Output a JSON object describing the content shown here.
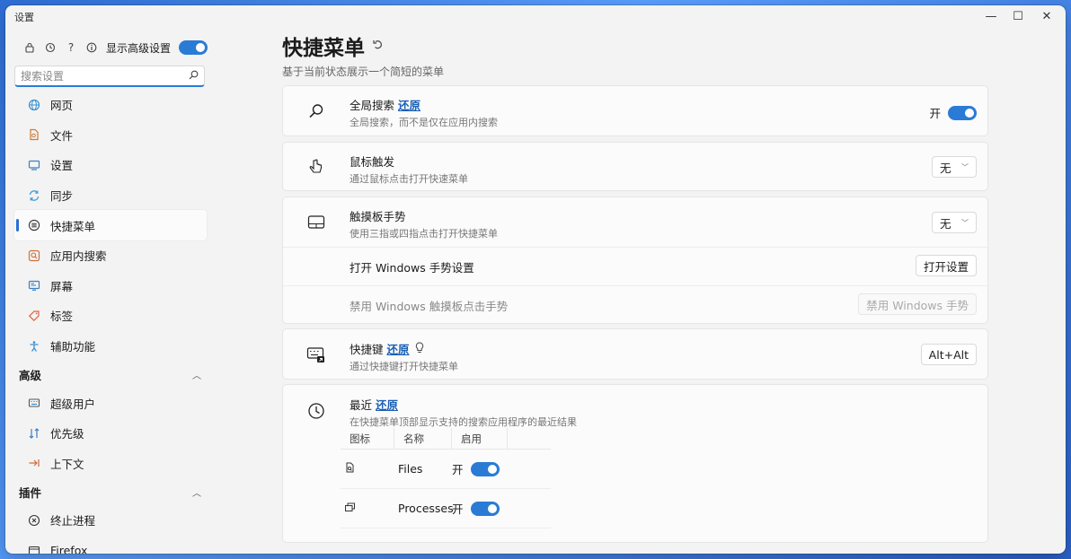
{
  "window": {
    "title": "设置",
    "min_glyph": "—",
    "max_glyph": "☐",
    "close_glyph": "✕"
  },
  "sidebar": {
    "top_icons": [
      "lock-icon",
      "history-icon",
      "help-icon",
      "info-icon"
    ],
    "help_glyph": "?",
    "show_advanced_label": "显示高级设置",
    "search_placeholder": "搜索设置",
    "items": [
      {
        "label": "网页",
        "icon": "globe-icon"
      },
      {
        "label": "文件",
        "icon": "file-icon"
      },
      {
        "label": "设置",
        "icon": "monitor-icon"
      },
      {
        "label": "同步",
        "icon": "sync-icon"
      },
      {
        "label": "快捷菜单",
        "icon": "menu-icon"
      },
      {
        "label": "应用内搜索",
        "icon": "app-search-icon"
      },
      {
        "label": "屏幕",
        "icon": "screen-icon"
      },
      {
        "label": "标签",
        "icon": "tag-icon"
      },
      {
        "label": "辅助功能",
        "icon": "accessibility-icon"
      }
    ],
    "section_advanced": "高级",
    "advanced_items": [
      {
        "label": "超级用户",
        "icon": "keyboard-icon"
      },
      {
        "label": "优先级",
        "icon": "sort-icon"
      },
      {
        "label": "上下文",
        "icon": "arrow-right-bar-icon"
      }
    ],
    "section_plugins": "插件",
    "plugin_items": [
      {
        "label": "终止进程",
        "icon": "close-circle-icon"
      },
      {
        "label": "Firefox",
        "icon": "firefox-icon"
      }
    ]
  },
  "main": {
    "title": "快捷菜单",
    "subtitle": "基于当前状态展示一个简短的菜单",
    "reset_label": "还原",
    "global_search": {
      "title": "全局搜索",
      "desc": "全局搜索，而不是仅在应用内搜索",
      "state_label": "开"
    },
    "mouse_trigger": {
      "title": "鼠标触发",
      "desc": "通过鼠标点击打开快速菜单",
      "value": "无"
    },
    "touchpad": {
      "title": "触摸板手势",
      "desc": "使用三指或四指点击打开快捷菜单",
      "value": "无",
      "open_settings_title": "打开 Windows 手势设置",
      "open_settings_button": "打开设置",
      "disable_title": "禁用 Windows 触摸板点击手势",
      "disable_button": "禁用 Windows 手势"
    },
    "shortcut": {
      "title": "快捷键",
      "desc": "通过快捷键打开快捷菜单",
      "value": "Alt+Alt"
    },
    "recent": {
      "title": "最近",
      "desc": "在快捷菜单顶部显示支持的搜索应用程序的最近结果",
      "columns": [
        "图标",
        "名称",
        "启用"
      ],
      "rows": [
        {
          "icon": "file-search-icon",
          "name": "Files",
          "state": "开"
        },
        {
          "icon": "windows-copy-icon",
          "name": "Processes",
          "state": "开"
        }
      ]
    }
  },
  "colors": {
    "accent": "#2a7bd6",
    "link": "#1a5fb4"
  }
}
